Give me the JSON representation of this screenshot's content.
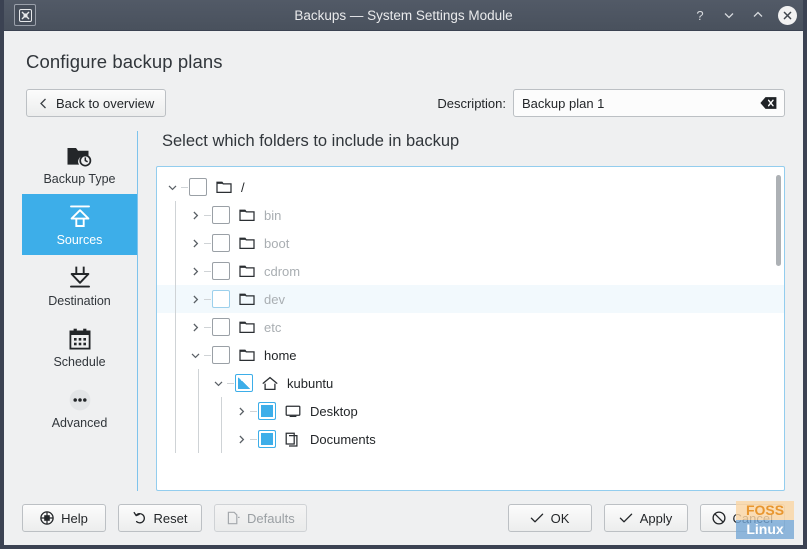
{
  "titlebar": {
    "title": "Backups — System Settings Module",
    "app_icon": "settings-module-icon",
    "help_label": "?",
    "shade_label": "∨",
    "unshade_label": "∧",
    "close_label": "✕"
  },
  "page": {
    "heading": "Configure backup plans",
    "back_button": "Back to overview",
    "description_label": "Description:",
    "description_value": "Backup plan 1",
    "description_placeholder": "Backup plan 1"
  },
  "sidebar": {
    "items": [
      {
        "label": "Backup Type",
        "icon": "folder-clock-icon",
        "selected": false
      },
      {
        "label": "Sources",
        "icon": "upload-arrow-icon",
        "selected": true
      },
      {
        "label": "Destination",
        "icon": "download-arrow-icon",
        "selected": false
      },
      {
        "label": "Schedule",
        "icon": "calendar-icon",
        "selected": false
      },
      {
        "label": "Advanced",
        "icon": "ellipsis-circle-icon",
        "selected": false
      }
    ]
  },
  "main": {
    "heading": "Select which folders to include in backup",
    "tree": [
      {
        "label": "/",
        "depth": 0,
        "expanded": true,
        "check": "unchecked",
        "icon": "folder-icon",
        "dim": false,
        "hovered": false
      },
      {
        "label": "bin",
        "depth": 1,
        "expanded": false,
        "check": "unchecked",
        "icon": "folder-icon",
        "dim": true,
        "hovered": false
      },
      {
        "label": "boot",
        "depth": 1,
        "expanded": false,
        "check": "unchecked",
        "icon": "folder-icon",
        "dim": true,
        "hovered": false
      },
      {
        "label": "cdrom",
        "depth": 1,
        "expanded": false,
        "check": "unchecked",
        "icon": "folder-icon",
        "dim": true,
        "hovered": false
      },
      {
        "label": "dev",
        "depth": 1,
        "expanded": false,
        "check": "unchecked",
        "icon": "folder-icon",
        "dim": true,
        "hovered": true
      },
      {
        "label": "etc",
        "depth": 1,
        "expanded": false,
        "check": "unchecked",
        "icon": "folder-icon",
        "dim": true,
        "hovered": false
      },
      {
        "label": "home",
        "depth": 1,
        "expanded": true,
        "check": "unchecked",
        "icon": "folder-icon",
        "dim": false,
        "hovered": false
      },
      {
        "label": "kubuntu",
        "depth": 2,
        "expanded": true,
        "check": "partial",
        "icon": "home-icon",
        "dim": false,
        "hovered": false
      },
      {
        "label": "Desktop",
        "depth": 3,
        "expanded": false,
        "check": "checked",
        "icon": "desktop-icon",
        "dim": false,
        "hovered": false
      },
      {
        "label": "Documents",
        "depth": 3,
        "expanded": false,
        "check": "checked",
        "icon": "documents-icon",
        "dim": false,
        "hovered": false
      }
    ],
    "scrollbar": {
      "name": "tree-vertical-scrollbar"
    }
  },
  "footer": {
    "help": "Help",
    "reset": "Reset",
    "defaults": "Defaults",
    "ok": "OK",
    "apply": "Apply",
    "cancel": "Cancel",
    "defaults_disabled": true
  },
  "watermark": {
    "line1": "FOSS",
    "line2": "Linux"
  },
  "colors": {
    "accent": "#3daee9",
    "titlebar": "#4e5663",
    "window_bg": "#eff0f1",
    "text": "#232629",
    "dim_text": "#a9aeb2"
  }
}
